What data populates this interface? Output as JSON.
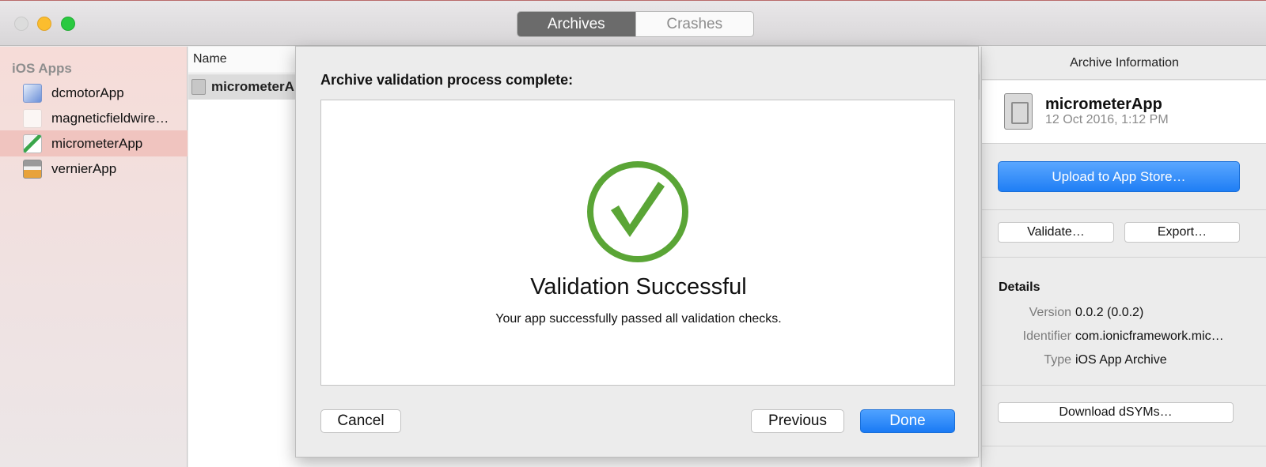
{
  "titlebar": {
    "tabs": [
      {
        "label": "Archives",
        "active": true
      },
      {
        "label": "Crashes",
        "active": false
      }
    ]
  },
  "sidebar": {
    "heading": "iOS Apps",
    "items": [
      {
        "label": "dcmotorApp",
        "icon": "app-icon-dcmotor",
        "selected": false
      },
      {
        "label": "magneticfieldwire…",
        "icon": "app-icon-magneticfield",
        "selected": false
      },
      {
        "label": "micrometerApp",
        "icon": "app-icon-micrometer",
        "selected": true
      },
      {
        "label": "vernierApp",
        "icon": "app-icon-vernier",
        "selected": false
      }
    ]
  },
  "list": {
    "header_name": "Name",
    "rows": [
      {
        "name": "micrometerAp"
      }
    ]
  },
  "inspector": {
    "title": "Archive Information",
    "archive_name": "micrometerApp",
    "archive_date": "12 Oct 2016, 1:12 PM",
    "upload_label": "Upload to App Store…",
    "validate_label": "Validate…",
    "export_label": "Export…",
    "details_heading": "Details",
    "details": [
      {
        "key": "Version",
        "value": "0.0.2 (0.0.2)"
      },
      {
        "key": "Identifier",
        "value": "com.ionicframework.mic…"
      },
      {
        "key": "Type",
        "value": "iOS App Archive"
      }
    ],
    "download_dsyms_label": "Download dSYMs…"
  },
  "sheet": {
    "title": "Archive validation process complete:",
    "success_title": "Validation Successful",
    "success_message": "Your app successfully passed all validation checks.",
    "cancel_label": "Cancel",
    "previous_label": "Previous",
    "done_label": "Done",
    "check_color": "#5aa536"
  },
  "colors": {
    "accent": "#1a7af4",
    "selection": "#f0c4bf"
  }
}
